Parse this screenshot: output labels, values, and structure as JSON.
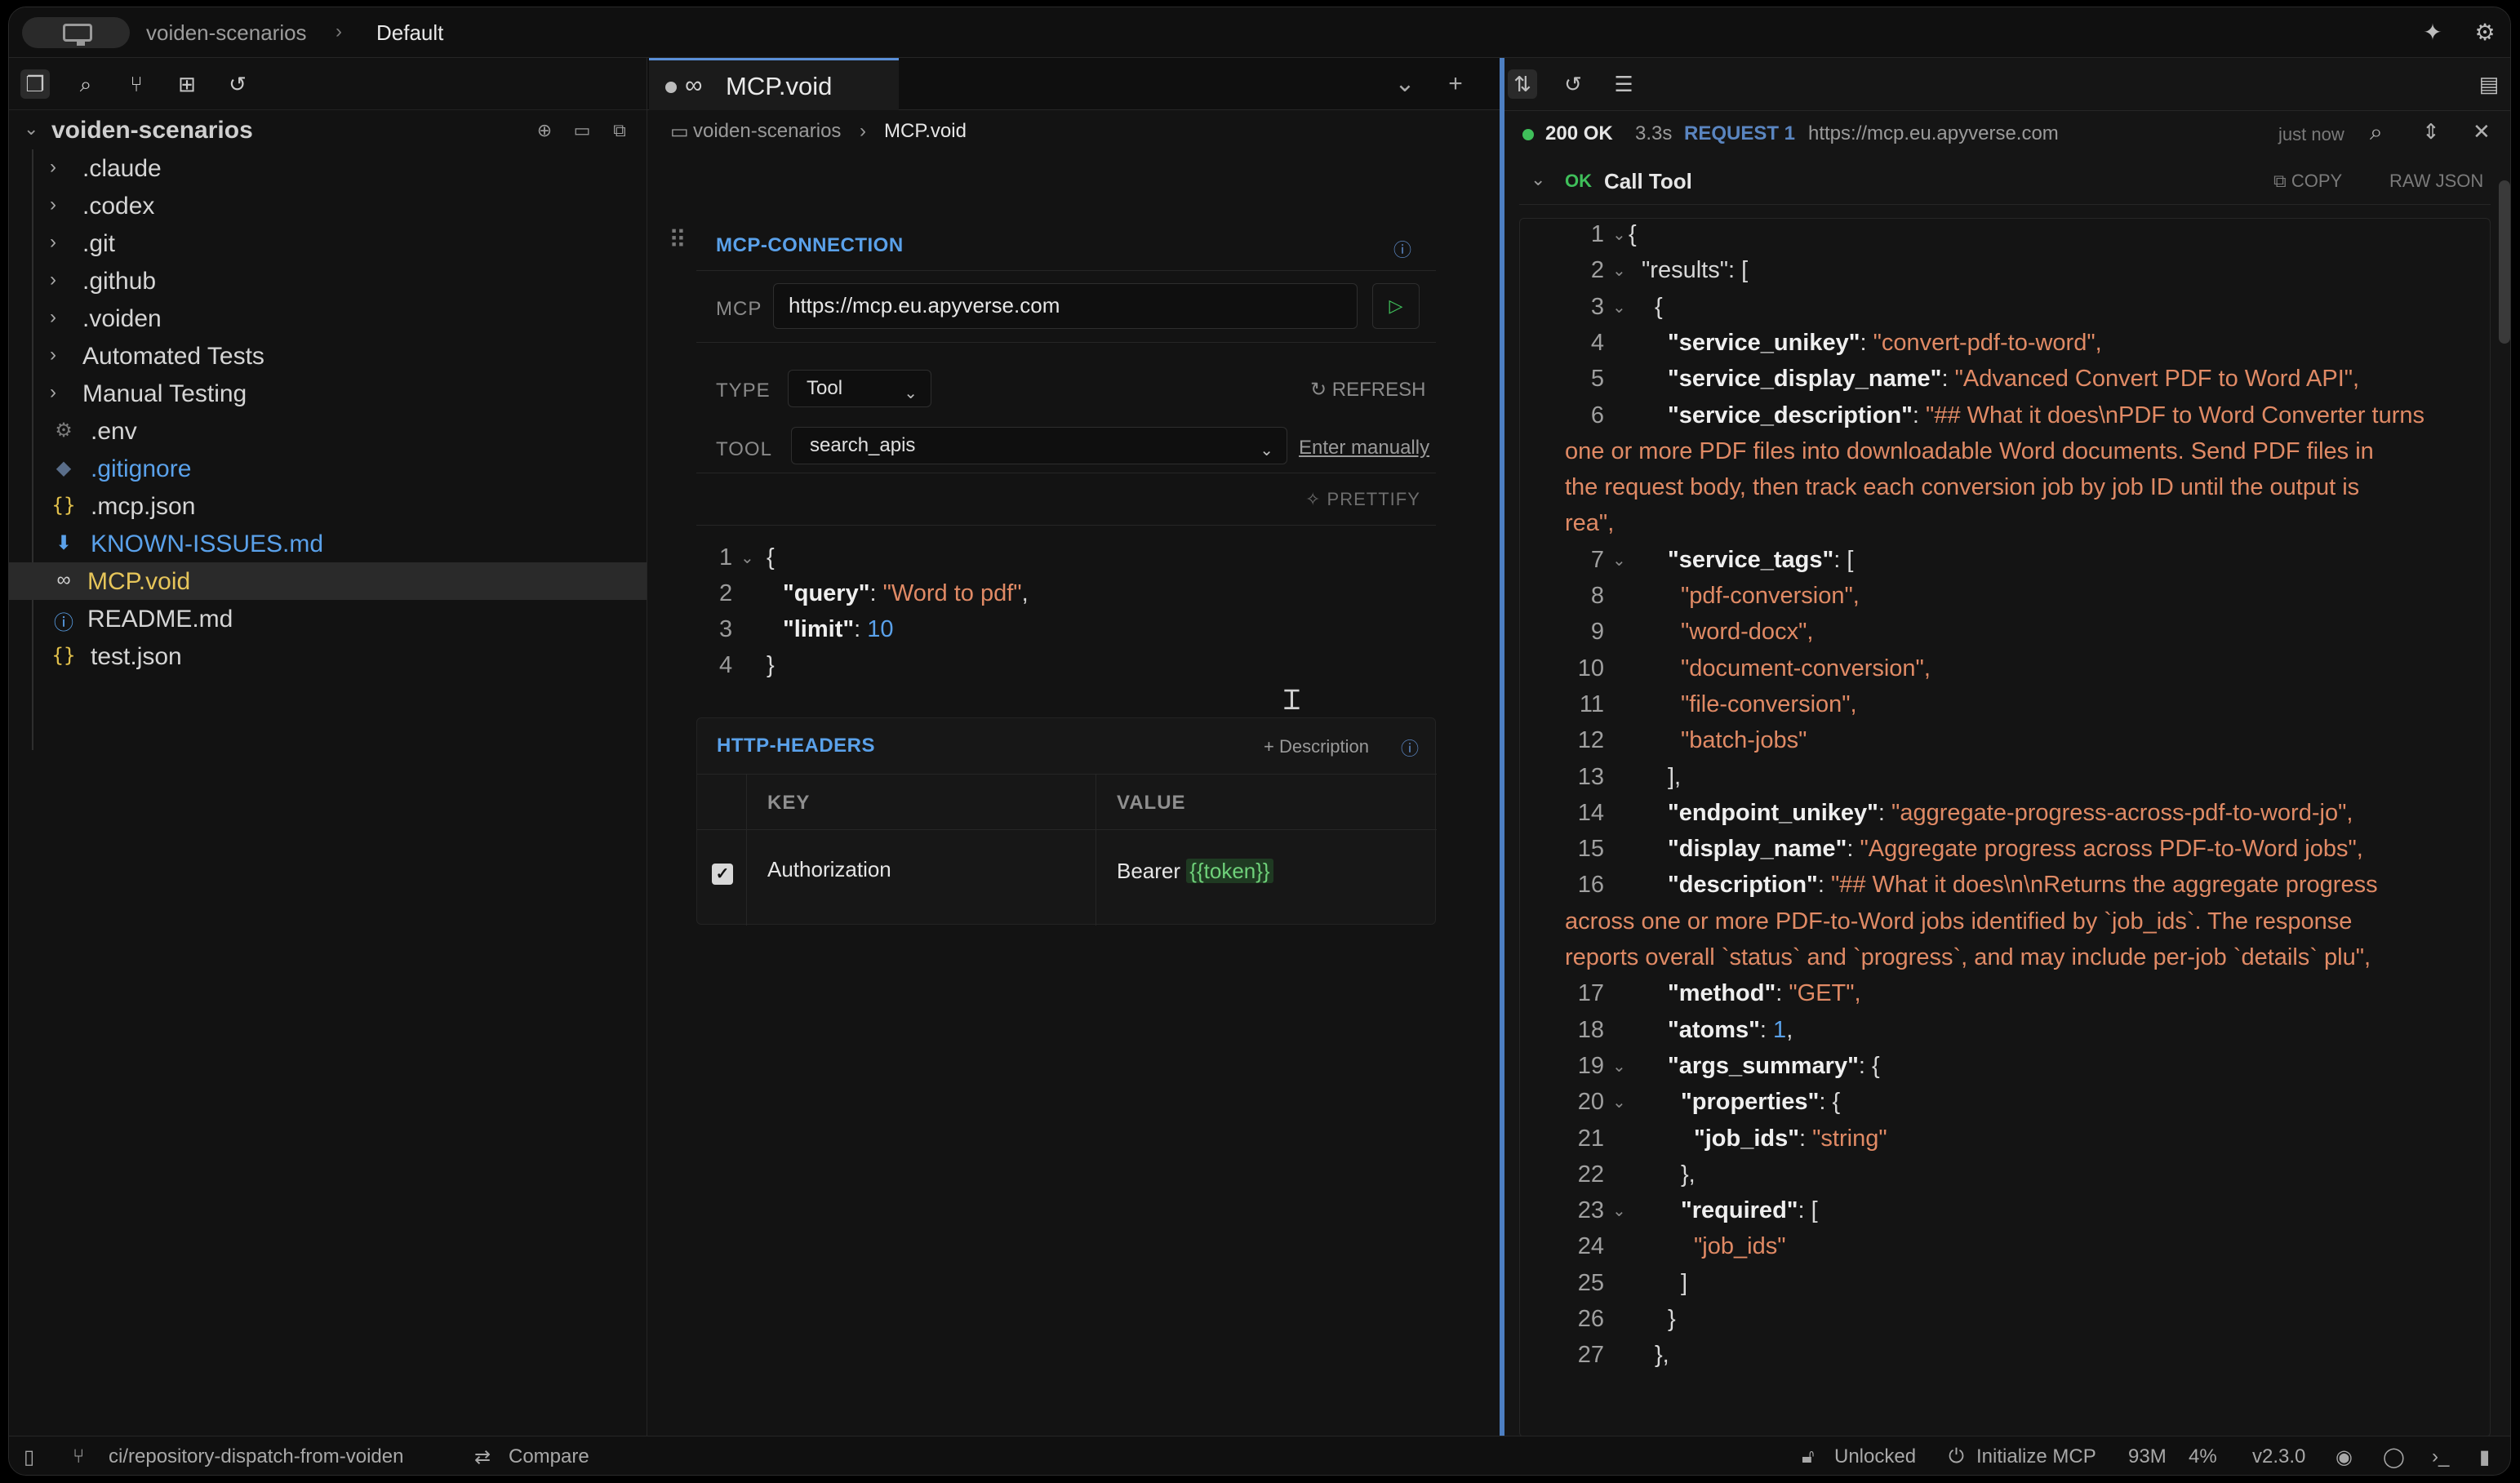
{
  "titlebar": {
    "workspace": "voiden-scenarios",
    "environment": "Default"
  },
  "sidebar": {
    "root": "voiden-scenarios",
    "items": [
      {
        "label": ".claude",
        "type": "folder"
      },
      {
        "label": ".codex",
        "type": "folder"
      },
      {
        "label": ".git",
        "type": "folder"
      },
      {
        "label": ".github",
        "type": "folder"
      },
      {
        "label": ".voiden",
        "type": "folder"
      },
      {
        "label": "Automated Tests",
        "type": "folder"
      },
      {
        "label": "Manual Testing",
        "type": "folder"
      },
      {
        "label": ".env",
        "type": "file"
      },
      {
        "label": ".gitignore",
        "type": "file"
      },
      {
        "label": ".mcp.json",
        "type": "file"
      },
      {
        "label": "KNOWN-ISSUES.md",
        "type": "file"
      },
      {
        "label": "MCP.void",
        "type": "file"
      },
      {
        "label": "README.md",
        "type": "file"
      },
      {
        "label": "test.json",
        "type": "file"
      }
    ]
  },
  "editor": {
    "tab_name": "MCP.void",
    "breadcrumb": [
      "voiden-scenarios",
      "MCP.void"
    ],
    "mcp_connection": {
      "title": "MCP-CONNECTION",
      "mcp_label": "MCP",
      "url": "https://mcp.eu.apyverse.com",
      "type_label": "TYPE",
      "type_value": "Tool",
      "refresh_label": "REFRESH",
      "tool_label": "TOOL",
      "tool_value": "search_apis",
      "enter_manually": "Enter manually",
      "prettify": "PRETTIFY",
      "lines": [
        "1",
        "2",
        "3",
        "4"
      ],
      "body": {
        "open": "{",
        "k1": "\"query\"",
        "v1": "\"Word to pdf\"",
        "k2": "\"limit\"",
        "v2": "10",
        "close": "}"
      }
    },
    "http_headers": {
      "title": "HTTP-HEADERS",
      "add_description": "+ Description",
      "col_key": "KEY",
      "col_value": "VALUE",
      "row_key": "Authorization",
      "row_value_prefix": "Bearer",
      "row_value_var": "{{token}}"
    }
  },
  "response": {
    "status": "200 OK",
    "time": "3.3s",
    "request": "REQUEST 1",
    "url": "https://mcp.eu.apyverse.com",
    "when": "just now",
    "ok": "OK",
    "section": "Call Tool",
    "copy": "COPY",
    "raw_json": "RAW JSON",
    "json_lines": [
      {
        "n": "1",
        "t": "{"
      },
      {
        "n": "2",
        "t": "\"results\": ["
      },
      {
        "n": "3",
        "t": "{"
      },
      {
        "n": "4",
        "k": "\"service_unikey\"",
        "v": "\"convert-pdf-to-word\","
      },
      {
        "n": "5",
        "k": "\"service_display_name\"",
        "v": "\"Advanced Convert PDF to Word API\","
      },
      {
        "n": "6",
        "k": "\"service_description\"",
        "v": "\"## What it does\\nPDF to Word Converter turns"
      },
      {
        "n": "",
        "v": "one or more PDF files into downloadable Word documents. Send PDF files in"
      },
      {
        "n": "",
        "v": "the request body, then track each conversion job by job ID until the output is"
      },
      {
        "n": "",
        "v": "rea\","
      },
      {
        "n": "7",
        "k": "\"service_tags\"",
        "t2": ": ["
      },
      {
        "n": "8",
        "v": "\"pdf-conversion\","
      },
      {
        "n": "9",
        "v": "\"word-docx\","
      },
      {
        "n": "10",
        "v": "\"document-conversion\","
      },
      {
        "n": "11",
        "v": "\"file-conversion\","
      },
      {
        "n": "12",
        "v": "\"batch-jobs\""
      },
      {
        "n": "13",
        "t": "],"
      },
      {
        "n": "14",
        "k": "\"endpoint_unikey\"",
        "v": "\"aggregate-progress-across-pdf-to-word-jo\","
      },
      {
        "n": "15",
        "k": "\"display_name\"",
        "v": "\"Aggregate progress across PDF-to-Word jobs\","
      },
      {
        "n": "16",
        "k": "\"description\"",
        "v": "\"## What it does\\n\\nReturns the aggregate progress"
      },
      {
        "n": "",
        "v": "across one or more PDF-to-Word jobs identified by `job_ids`. The response"
      },
      {
        "n": "",
        "v": "reports overall `status` and `progress`, and may include per-job `details` plu\","
      },
      {
        "n": "17",
        "k": "\"method\"",
        "v": "\"GET\","
      },
      {
        "n": "18",
        "k": "\"atoms\"",
        "num": "1"
      },
      {
        "n": "19",
        "k": "\"args_summary\"",
        "t2": ": {"
      },
      {
        "n": "20",
        "k": "\"properties\"",
        "t2": ": {"
      },
      {
        "n": "21",
        "k": "\"job_ids\"",
        "v": "\"string\""
      },
      {
        "n": "22",
        "t": "},"
      },
      {
        "n": "23",
        "k": "\"required\"",
        "t2": ": ["
      },
      {
        "n": "24",
        "v": "\"job_ids\""
      },
      {
        "n": "25",
        "t": "]"
      },
      {
        "n": "26",
        "t": "}"
      },
      {
        "n": "27",
        "t": "},"
      }
    ]
  },
  "statusbar": {
    "branch": "ci/repository-dispatch-from-voiden",
    "compare": "Compare",
    "unlocked": "Unlocked",
    "init": "Initialize MCP",
    "mem": "93M",
    "cpu": "4%",
    "version": "v2.3.0"
  },
  "colors": {
    "accent": "#5aa1ea",
    "string": "#e08a65",
    "ok": "#3fbf5a"
  }
}
